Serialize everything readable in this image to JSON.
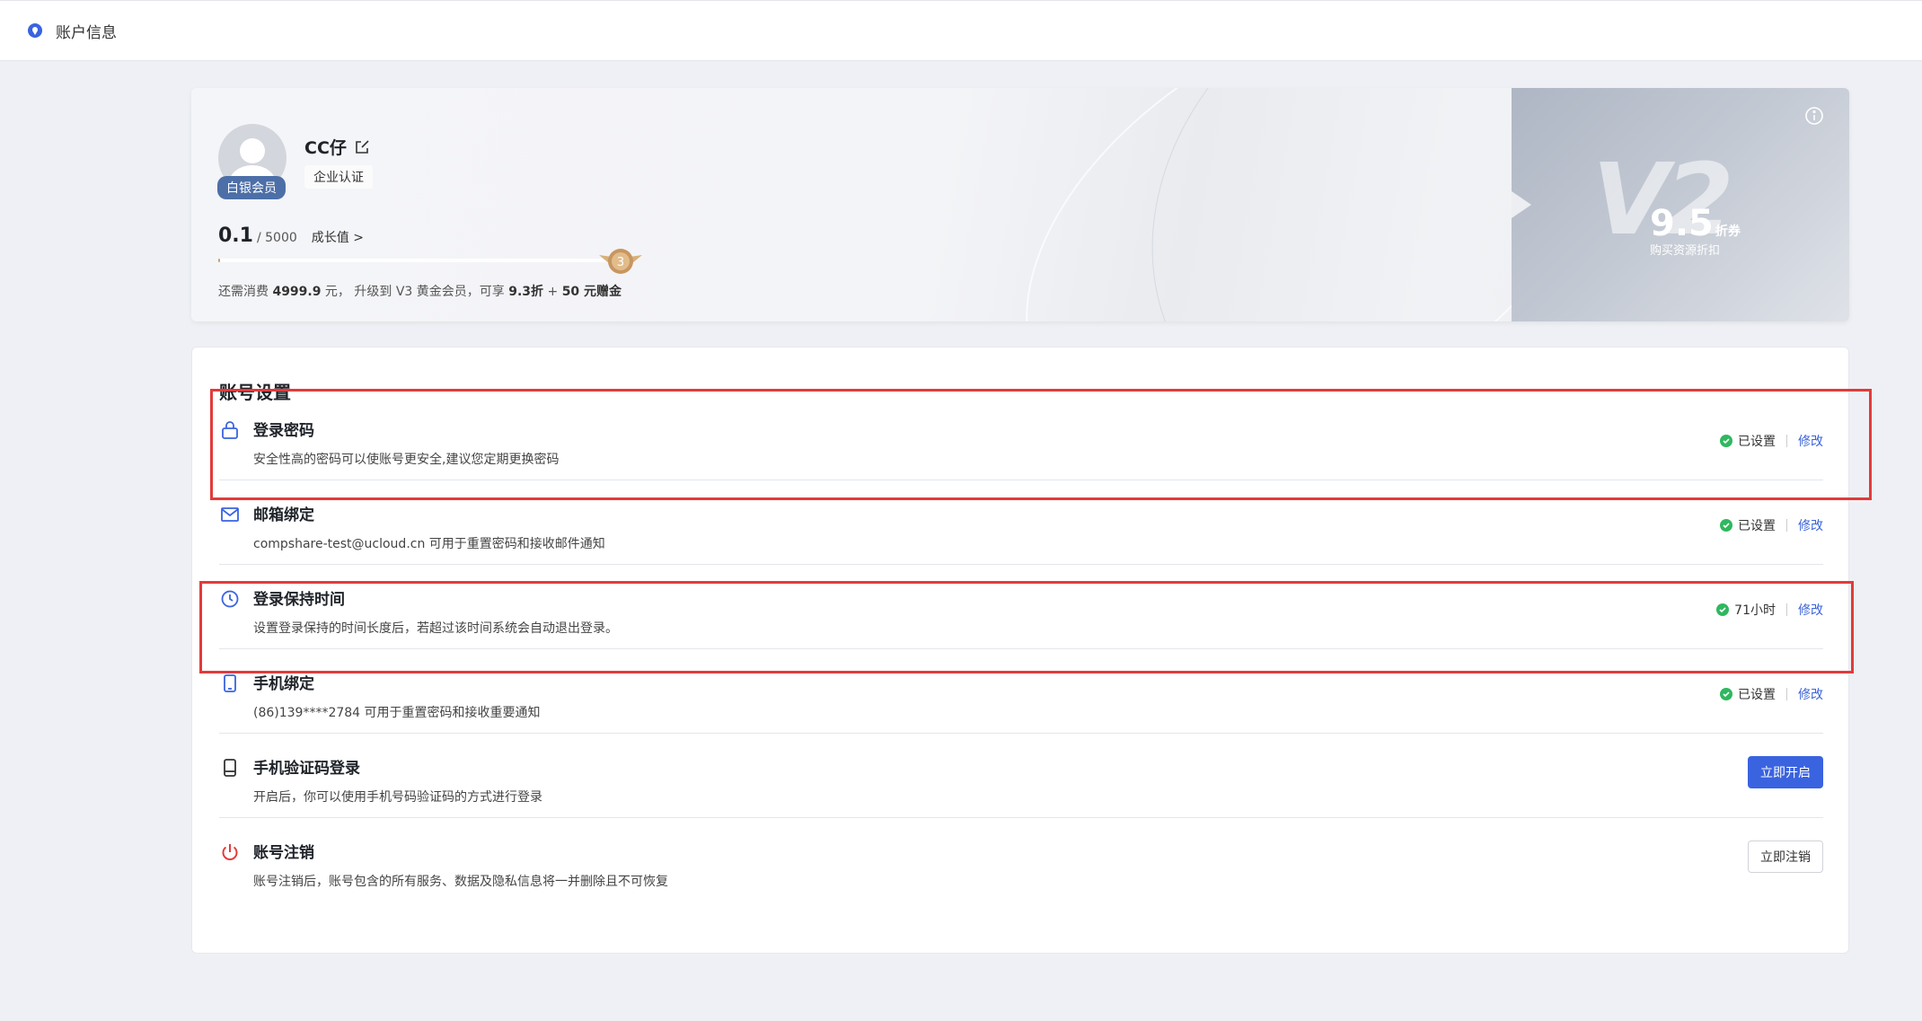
{
  "header": {
    "title": "账户信息"
  },
  "profile": {
    "username": "CC仔",
    "tier_badge": "白银会员",
    "certification": "企业认证",
    "growth_current": "0.1",
    "growth_max": "/ 5000",
    "growth_link": "成长值 >",
    "progress_fraction": 2e-05,
    "medal_level": "3",
    "upgrade": {
      "prefix": "还需消费 ",
      "amount": "4999.9",
      "mid1": " 元， 升级到  V3 黄金会员，可享 ",
      "discount": "9.3折",
      "mid2": " + ",
      "bonus": "50 元赠金"
    },
    "vip": {
      "level": "V2",
      "discount_num": "9.5",
      "discount_unit": "折券",
      "discount_label": "购买资源折扣"
    }
  },
  "settings": {
    "title": "账号设置",
    "rows": [
      {
        "title": "登录密码",
        "desc": "安全性高的密码可以使账号更安全,建议您定期更换密码",
        "status": "已设置",
        "action": "修改"
      },
      {
        "title": "邮箱绑定",
        "desc": "compshare-test@ucloud.cn 可用于重置密码和接收邮件通知",
        "status": "已设置",
        "action": "修改"
      },
      {
        "title": "登录保持时间",
        "desc": "设置登录保持的时间长度后，若超过该时间系统会自动退出登录。",
        "status": "71小时",
        "action": "修改"
      },
      {
        "title": "手机绑定",
        "desc": "(86)139****2784 可用于重置密码和接收重要通知",
        "status": "已设置",
        "action": "修改"
      },
      {
        "title": "手机验证码登录",
        "desc": "开启后，你可以使用手机号码验证码的方式进行登录",
        "button": "立即开启"
      },
      {
        "title": "账号注销",
        "desc": "账号注销后，账号包含的所有服务、数据及隐私信息将一并删除且不可恢复",
        "button": "立即注销"
      }
    ]
  },
  "colors": {
    "accent": "#3a63e0",
    "success": "#2fb85f",
    "danger": "#e23b3b",
    "highlight": "#e23b3b"
  }
}
